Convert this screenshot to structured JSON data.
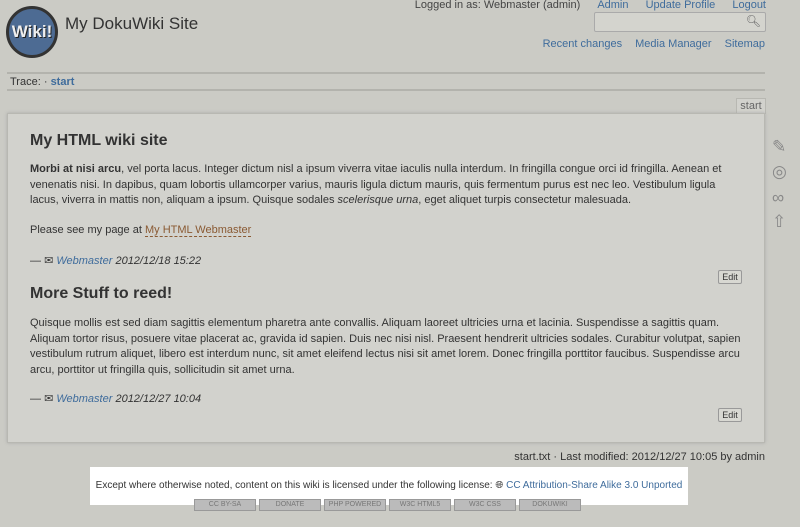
{
  "header": {
    "user_text": "Logged in as: Webmaster (admin)",
    "admin": "Admin",
    "update_profile": "Update Profile",
    "logout": "Logout",
    "site_title": "My DokuWiki Site",
    "logo_text": "Wiki!",
    "search_placeholder": ""
  },
  "tools": [
    "Recent changes",
    "Media Manager",
    "Sitemap"
  ],
  "trace": {
    "label": "Trace:",
    "sep": "·",
    "item": "start"
  },
  "page_tab": "start",
  "sections": [
    {
      "heading": "My HTML wiki site",
      "bold": "Morbi at nisi arcu",
      "text1": ", vel porta lacus. Integer dictum nisl a ipsum viverra vitae iaculis nulla interdum. In fringilla congue orci id fringilla. Aenean et venenatis nisi. In dapibus, quam lobortis ullamcorper varius, mauris ligula dictum mauris, quis fermentum purus est nec leo. Vestibulum ligula lacus, viverra in mattis non, aliquam a ipsum. Quisque sodales ",
      "italic": "scelerisque urna",
      "text2": ", eget aliquet turpis consectetur malesuada.",
      "see": "Please see my page at ",
      "link": "My HTML Webmaster",
      "sig_dash": "—",
      "sig_name": "Webmaster",
      "sig_date": "2012/12/18 15:22",
      "edit": "Edit"
    },
    {
      "heading": "More Stuff to reed!",
      "text": "Quisque mollis est sed diam sagittis elementum pharetra ante convallis. Aliquam laoreet ultricies urna et lacinia. Suspendisse a sagittis quam. Aliquam tortor risus, posuere vitae placerat ac, gravida id sapien. Duis nec nisi nisl. Praesent hendrerit ultricies sodales. Curabitur volutpat, sapien vestibulum rutrum aliquet, libero est interdum nunc, sit amet eleifend lectus nisi sit amet lorem. Donec fringilla porttitor faucibus. Suspendisse arcu arcu, porttitor ut fringilla quis, sollicitudin sit amet urna.",
      "sig_dash": "—",
      "sig_name": "Webmaster",
      "sig_date": "2012/12/27 10:04",
      "edit": "Edit"
    }
  ],
  "footer": {
    "modified": "start.txt · Last modified: 2012/12/27 10:05 by admin",
    "license_text": "Except where otherwise noted, content on this wiki is licensed under the following license:",
    "license_link": "CC Attribution-Share Alike 3.0 Unported",
    "badges": [
      "CC BY-SA",
      "DONATE",
      "PHP POWERED",
      "W3C HTML5",
      "W3C CSS",
      "DOKUWIKI"
    ]
  }
}
